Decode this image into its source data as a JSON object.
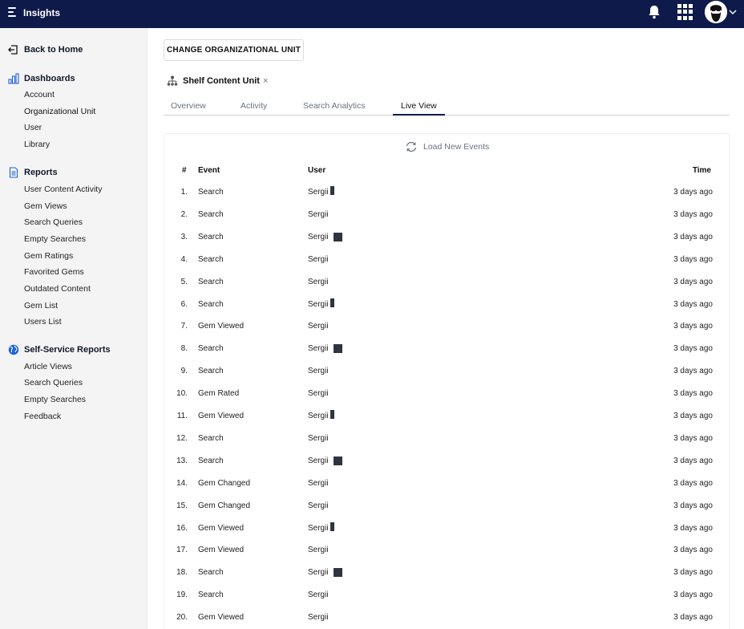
{
  "app": {
    "title": "Insights"
  },
  "sidebar": {
    "back_label": "Back to Home",
    "dashboards": {
      "label": "Dashboards",
      "items": [
        "Account",
        "Organizational Unit",
        "User",
        "Library"
      ]
    },
    "reports": {
      "label": "Reports",
      "items": [
        "User Content Activity",
        "Gem Views",
        "Search Queries",
        "Empty Searches",
        "Gem Ratings",
        "Favorited Gems",
        "Outdated Content",
        "Gem List",
        "Users List"
      ]
    },
    "self_service": {
      "label": "Self-Service Reports",
      "items": [
        "Article Views",
        "Search Queries",
        "Empty Searches",
        "Feedback"
      ]
    }
  },
  "main": {
    "change_button": "CHANGE ORGANIZATIONAL UNIT",
    "unit_name": "Shelf Content Unit",
    "unit_close": "×",
    "tabs": [
      "Overview",
      "Activity",
      "Search Analytics",
      "Live View"
    ],
    "active_tab": "Live View",
    "load_events": "Load New Events",
    "table": {
      "headers": {
        "num": "#",
        "event": "Event",
        "user": "User",
        "time": "Time"
      },
      "rows": [
        {
          "num": "1.",
          "event": "Search",
          "user": "Sergii",
          "time": "3 days ago"
        },
        {
          "num": "2.",
          "event": "Search",
          "user": "Sergii",
          "time": "3 days ago"
        },
        {
          "num": "3.",
          "event": "Search",
          "user": "Sergii",
          "time": "3 days ago"
        },
        {
          "num": "4.",
          "event": "Search",
          "user": "Sergii",
          "time": "3 days ago"
        },
        {
          "num": "5.",
          "event": "Search",
          "user": "Sergii",
          "time": "3 days ago"
        },
        {
          "num": "6.",
          "event": "Search",
          "user": "Sergii",
          "time": "3 days ago"
        },
        {
          "num": "7.",
          "event": "Gem Viewed",
          "user": "Sergii",
          "time": "3 days ago"
        },
        {
          "num": "8.",
          "event": "Search",
          "user": "Sergii",
          "time": "3 days ago"
        },
        {
          "num": "9.",
          "event": "Search",
          "user": "Sergii",
          "time": "3 days ago"
        },
        {
          "num": "10.",
          "event": "Gem Rated",
          "user": "Sergii",
          "time": "3 days ago"
        },
        {
          "num": "11.",
          "event": "Gem Viewed",
          "user": "Sergii",
          "time": "3 days ago"
        },
        {
          "num": "12.",
          "event": "Search",
          "user": "Sergii",
          "time": "3 days ago"
        },
        {
          "num": "13.",
          "event": "Search",
          "user": "Sergii",
          "time": "3 days ago"
        },
        {
          "num": "14.",
          "event": "Gem Changed",
          "user": "Sergii",
          "time": "3 days ago"
        },
        {
          "num": "15.",
          "event": "Gem Changed",
          "user": "Sergii",
          "time": "3 days ago"
        },
        {
          "num": "16.",
          "event": "Gem Viewed",
          "user": "Sergii",
          "time": "3 days ago"
        },
        {
          "num": "17.",
          "event": "Gem Viewed",
          "user": "Sergii",
          "time": "3 days ago"
        },
        {
          "num": "18.",
          "event": "Search",
          "user": "Sergii",
          "time": "3 days ago"
        },
        {
          "num": "19.",
          "event": "Search",
          "user": "Sergii",
          "time": "3 days ago"
        },
        {
          "num": "20.",
          "event": "Gem Viewed",
          "user": "Sergii",
          "time": "3 days ago"
        }
      ]
    }
  },
  "colors": {
    "topbar": "#0e1a4a",
    "sidebar": "#f4f4f5",
    "accent": "#1e63d6"
  }
}
